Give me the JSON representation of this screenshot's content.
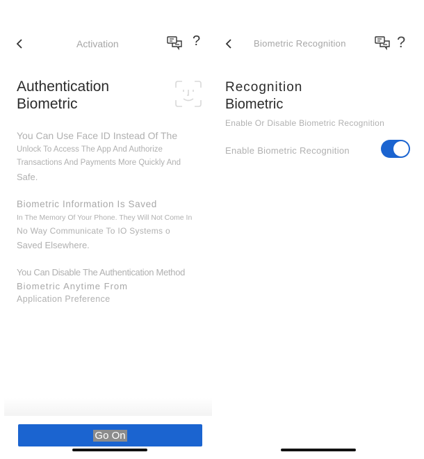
{
  "left_screen": {
    "nav": {
      "title": "Activation",
      "back_icon": "chevron-left-icon",
      "chat_icon": "chat-bubbles-icon",
      "help_label": "?"
    },
    "heading": {
      "line1": "Authentication",
      "line2": "Biometric",
      "icon": "face-id-icon"
    },
    "paragraphs": [
      {
        "lines": [
          "You Can Use Face ID Instead Of The",
          "Unlock To Access The App And Authorize",
          "Transactions And Payments More Quickly And",
          "Safe."
        ]
      },
      {
        "lines": [
          "Biometric Information Is Saved",
          "In The Memory Of Your Phone. They Will Not Come In",
          "No Way Communicate To IO Systems o",
          "Saved Elsewhere."
        ]
      },
      {
        "lines": [
          "You Can Disable The Authentication Method",
          "Biometric Anytime From",
          "Application Preference"
        ]
      }
    ],
    "primary_button": "Go On"
  },
  "right_screen": {
    "nav": {
      "title": "Biometric Recognition",
      "back_icon": "chevron-left-icon",
      "chat_icon": "chat-bubbles-icon",
      "help_label": "?"
    },
    "heading": {
      "line1": "Recognition",
      "line2": "Biometric"
    },
    "description": "Enable Or Disable Biometric Recognition",
    "setting": {
      "label": "Enable Biometric Recognition",
      "enabled": true,
      "accent": "#1b64d0"
    }
  }
}
